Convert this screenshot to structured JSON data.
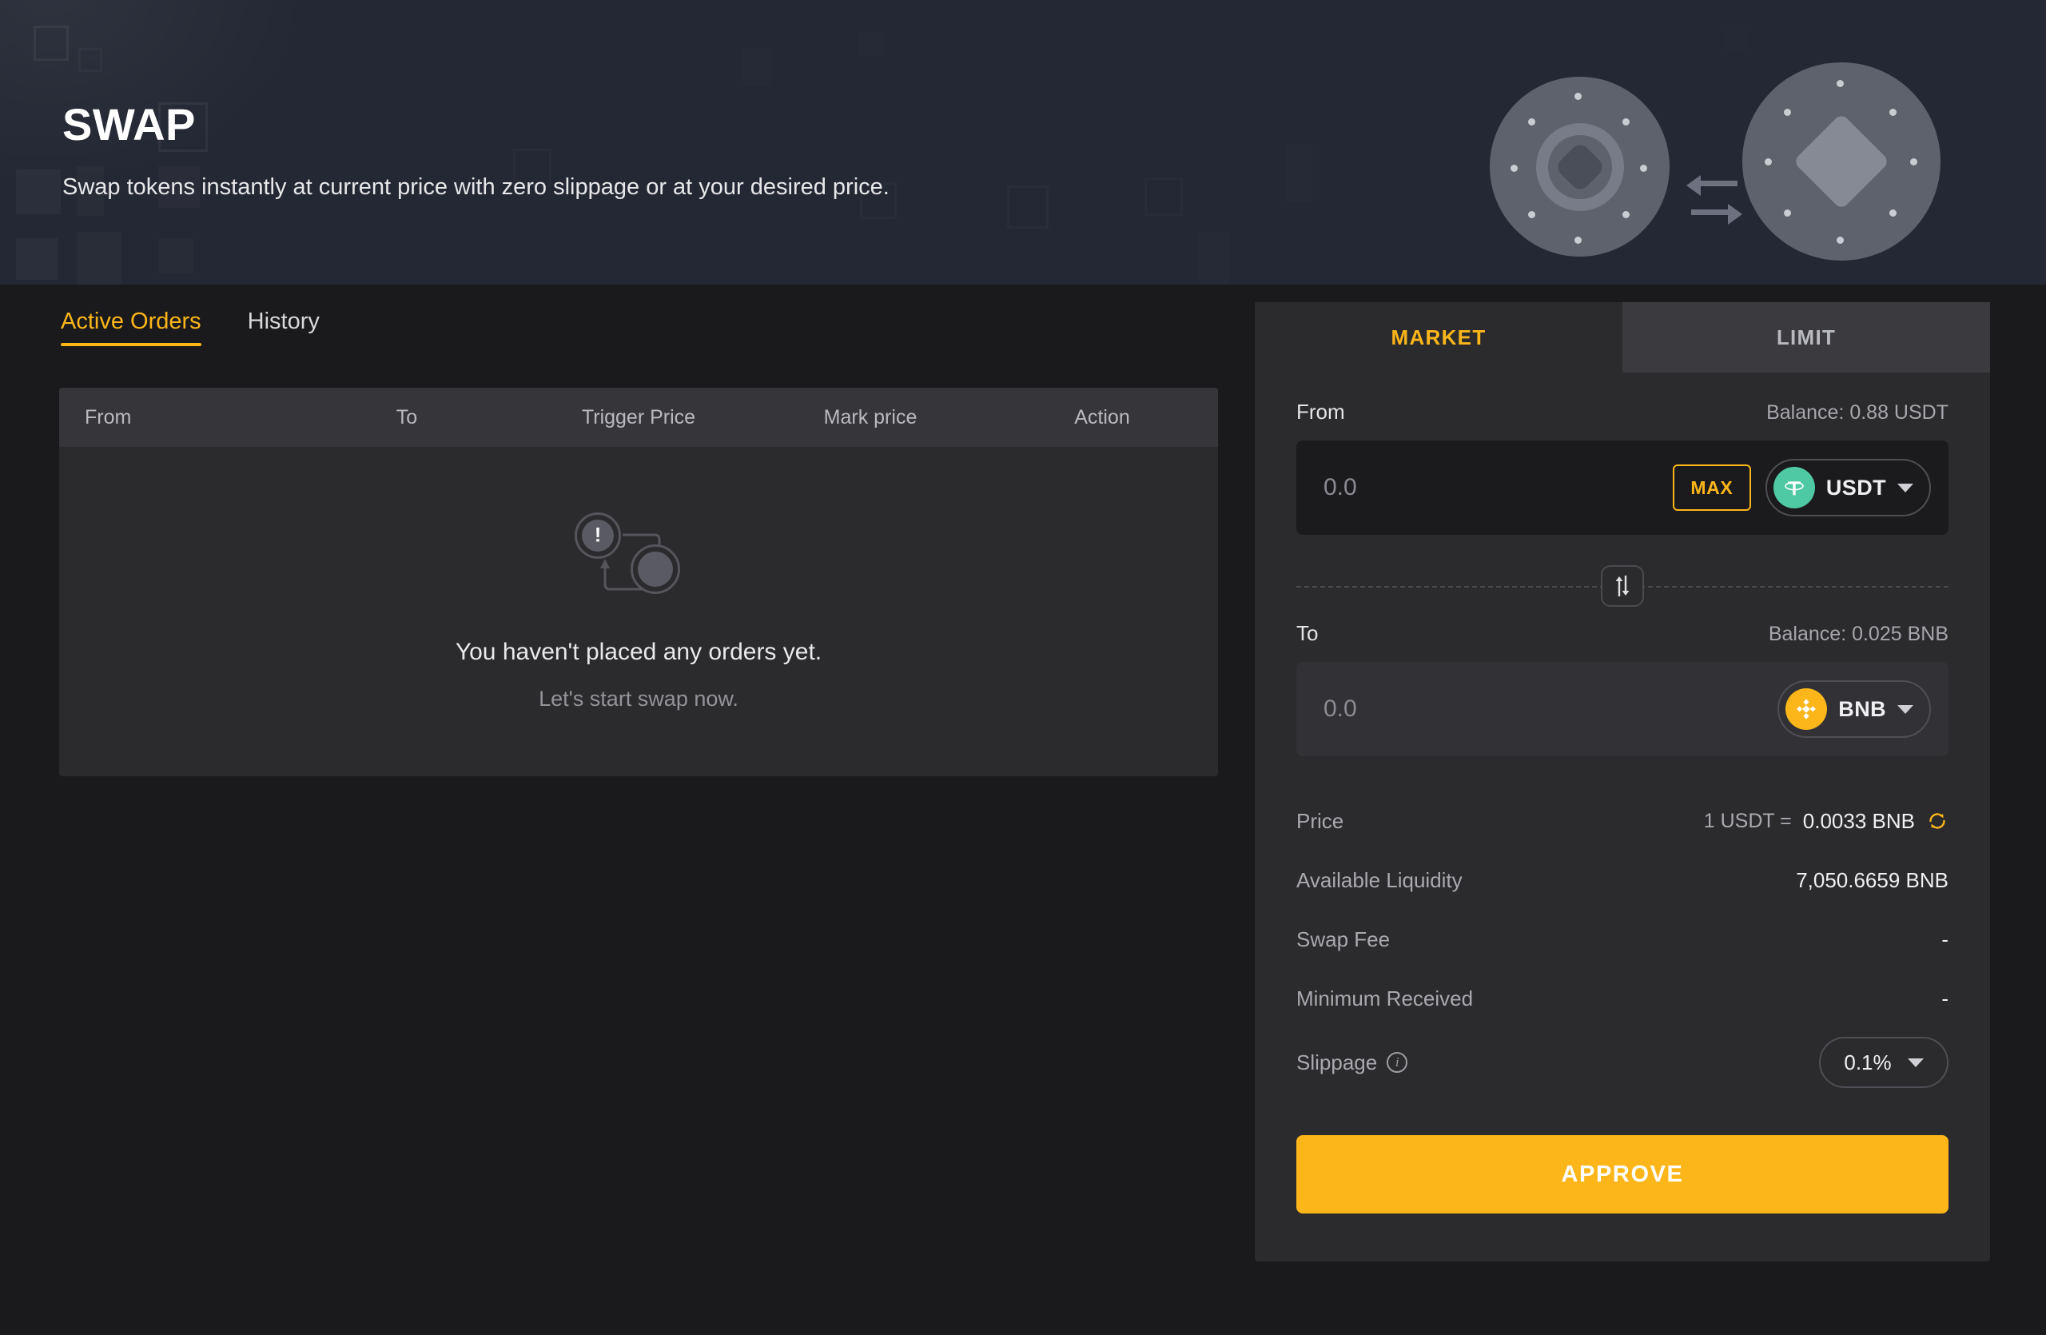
{
  "hero": {
    "title": "SWAP",
    "subtitle": "Swap tokens instantly at current price with zero slippage or at your desired price."
  },
  "orders": {
    "tabs": [
      {
        "label": "Active Orders",
        "active": true
      },
      {
        "label": "History",
        "active": false
      }
    ],
    "columns": [
      "From",
      "To",
      "Trigger Price",
      "Mark price",
      "Action"
    ],
    "empty": {
      "title": "You haven't placed any orders yet.",
      "subtitle": "Let's start swap now.",
      "icon": "swap-cycle-warning-icon"
    },
    "rows": []
  },
  "swap": {
    "mode_tabs": [
      {
        "label": "MARKET",
        "active": true
      },
      {
        "label": "LIMIT",
        "active": false
      }
    ],
    "from": {
      "label": "From",
      "balance": "Balance: 0.88 USDT",
      "amount": "",
      "placeholder": "0.0",
      "max_label": "MAX",
      "token": "USDT",
      "token_symbol": "₮",
      "token_color": "#4fc9a3"
    },
    "to": {
      "label": "To",
      "balance": "Balance: 0.025 BNB",
      "amount": "",
      "placeholder": "0.0",
      "token": "BNB",
      "token_symbol": "◈",
      "token_color": "#fcb619"
    },
    "switch_icon": "swap-vertical-icon",
    "details": [
      {
        "label": "Price",
        "unit": "1 USDT =",
        "value": "0.0033 BNB",
        "icon": "refresh-icon"
      },
      {
        "label": "Available Liquidity",
        "value": "7,050.6659 BNB"
      },
      {
        "label": "Swap Fee",
        "value": "-"
      },
      {
        "label": "Minimum Received",
        "value": "-"
      }
    ],
    "slippage": {
      "label": "Slippage",
      "info_icon": "info-icon",
      "value": "0.1%"
    },
    "submit_label": "APPROVE"
  },
  "colors": {
    "accent": "#fcb619",
    "hero_bg": "#242834",
    "page_bg": "#1a1a1c",
    "card_bg": "#2b2b2d",
    "usdt": "#4fc9a3",
    "bnb": "#fcb619"
  }
}
